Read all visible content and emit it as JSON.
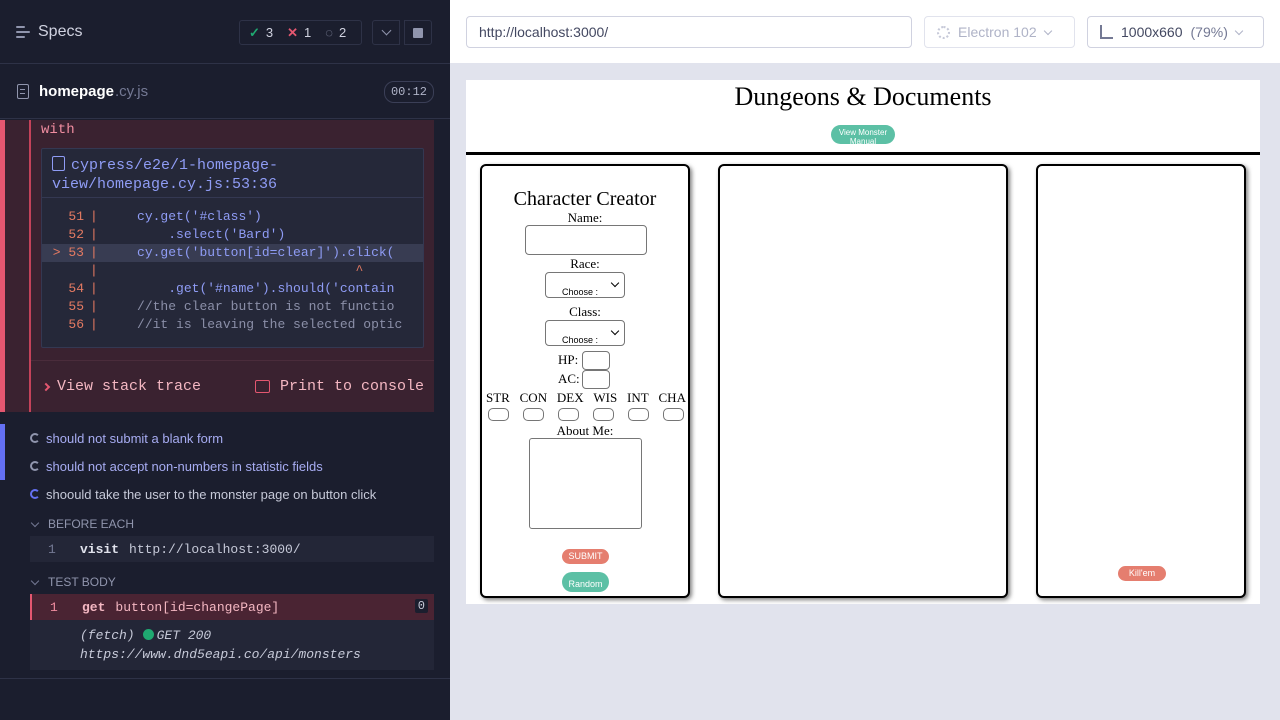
{
  "reporter": {
    "title": "Specs",
    "stats": {
      "passed": "3",
      "failed": "1",
      "pending": "2"
    },
    "file": {
      "name": "homepage",
      "ext": ".cy.js",
      "time": "00:12"
    },
    "error": {
      "with_text": "with",
      "frame_path": "cypress/e2e/1-homepage-view/homepage.cy.js:53:36",
      "lines": [
        {
          "num": "51",
          "text": "cy.get('#class')"
        },
        {
          "num": "52",
          "text": ".select('Bard')"
        },
        {
          "num": "> 53",
          "text": "cy.get('button[id=clear]').click("
        },
        {
          "num": "",
          "text": "^"
        },
        {
          "num": "54",
          "text": ".get('#name').should('contain"
        },
        {
          "num": "55",
          "text": "//the clear button is not functio"
        },
        {
          "num": "56",
          "text": "//it is leaving the selected optic"
        }
      ],
      "view_stack": "View stack trace",
      "print_console": "Print to console"
    },
    "tests": [
      "should not submit a blank form",
      "should not accept non-numbers in statistic fields",
      "shoould take the user to the monster page on button click"
    ],
    "before_each": {
      "label": "BEFORE EACH",
      "cmd_num": "1",
      "cmd_name": "visit",
      "cmd_msg": "http://localhost:3000/"
    },
    "test_body": {
      "label": "TEST BODY",
      "cmd_num": "1",
      "cmd_name": "get",
      "cmd_msg": "button[id=changePage]",
      "badge": "0",
      "fetch_label": "(fetch)",
      "fetch_status": "GET 200",
      "fetch_url": "https://www.dnd5eapi.co/api/monsters"
    }
  },
  "aut": {
    "url": "http://localhost:3000/",
    "browser": "Electron 102",
    "viewport": "1000x660",
    "scale": "(79%)",
    "app": {
      "title": "Dungeons & Documents",
      "monster_button": "View Monster Manual",
      "creator_title": "Character Creator",
      "name_label": "Name:",
      "race_label": "Race:",
      "race_select": "Choose :",
      "class_label": "Class:",
      "class_select": "Choose :",
      "hp_label": "HP:",
      "ac_label": "AC:",
      "stats": [
        "STR",
        "CON",
        "DEX",
        "WIS",
        "INT",
        "CHA"
      ],
      "about_label": "About Me:",
      "submit": "SUBMIT",
      "random": "Random",
      "killem": "Kill'em"
    }
  },
  "colors": {
    "pass": "#1fa971",
    "fail": "#e45770",
    "accent": "#6470f3",
    "app_green": "#5cc0a5",
    "app_red": "#e57e6f"
  }
}
